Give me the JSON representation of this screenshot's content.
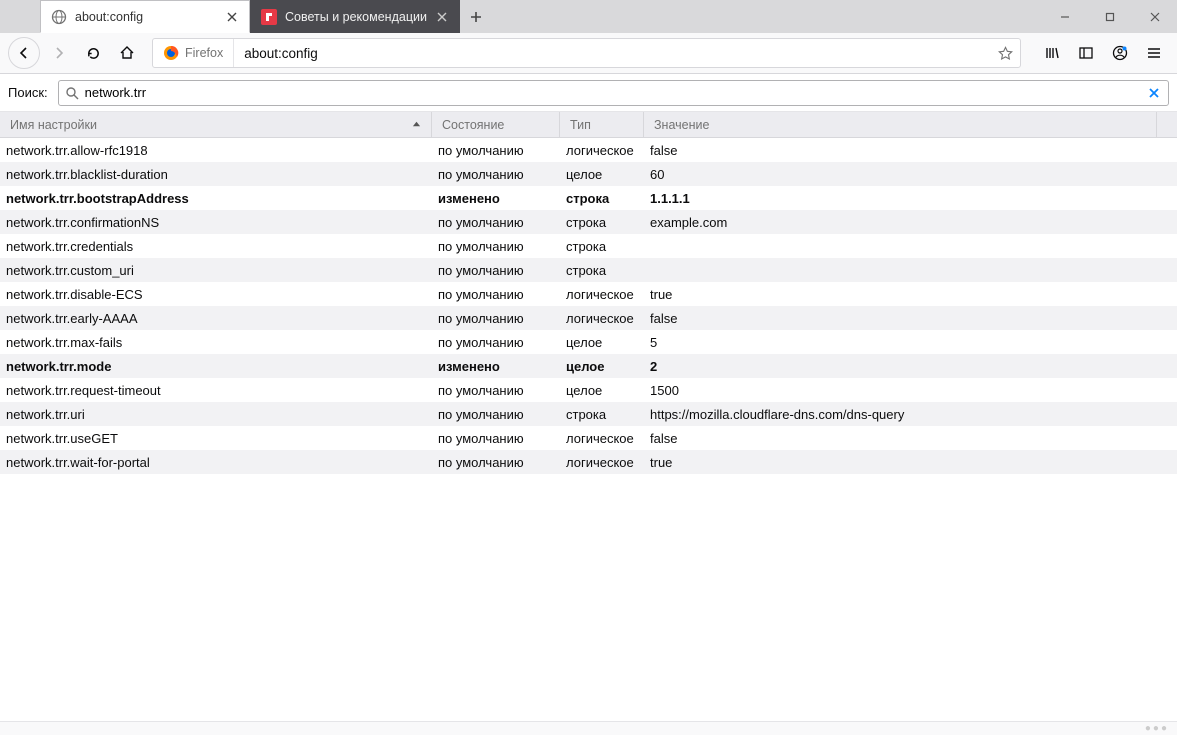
{
  "tabs": [
    {
      "title": "about:config",
      "active": true
    },
    {
      "title": "Советы и рекомендации",
      "active": false
    }
  ],
  "urlbar": {
    "brand": "Firefox",
    "address": "about:config"
  },
  "search": {
    "label": "Поиск:",
    "value": "network.trr"
  },
  "columns": {
    "name": "Имя настройки",
    "status": "Состояние",
    "type": "Тип",
    "value": "Значение"
  },
  "status_default": "по умолчанию",
  "status_modified": "изменено",
  "type_bool": "логическое",
  "type_int": "целое",
  "type_str": "строка",
  "prefs": [
    {
      "name": "network.trr.allow-rfc1918",
      "modified": false,
      "type": "bool",
      "value": "false"
    },
    {
      "name": "network.trr.blacklist-duration",
      "modified": false,
      "type": "int",
      "value": "60"
    },
    {
      "name": "network.trr.bootstrapAddress",
      "modified": true,
      "type": "str",
      "value": "1.1.1.1"
    },
    {
      "name": "network.trr.confirmationNS",
      "modified": false,
      "type": "str",
      "value": "example.com"
    },
    {
      "name": "network.trr.credentials",
      "modified": false,
      "type": "str",
      "value": ""
    },
    {
      "name": "network.trr.custom_uri",
      "modified": false,
      "type": "str",
      "value": ""
    },
    {
      "name": "network.trr.disable-ECS",
      "modified": false,
      "type": "bool",
      "value": "true"
    },
    {
      "name": "network.trr.early-AAAA",
      "modified": false,
      "type": "bool",
      "value": "false"
    },
    {
      "name": "network.trr.max-fails",
      "modified": false,
      "type": "int",
      "value": "5"
    },
    {
      "name": "network.trr.mode",
      "modified": true,
      "type": "int",
      "value": "2"
    },
    {
      "name": "network.trr.request-timeout",
      "modified": false,
      "type": "int",
      "value": "1500"
    },
    {
      "name": "network.trr.uri",
      "modified": false,
      "type": "str",
      "value": "https://mozilla.cloudflare-dns.com/dns-query"
    },
    {
      "name": "network.trr.useGET",
      "modified": false,
      "type": "bool",
      "value": "false"
    },
    {
      "name": "network.trr.wait-for-portal",
      "modified": false,
      "type": "bool",
      "value": "true"
    }
  ]
}
